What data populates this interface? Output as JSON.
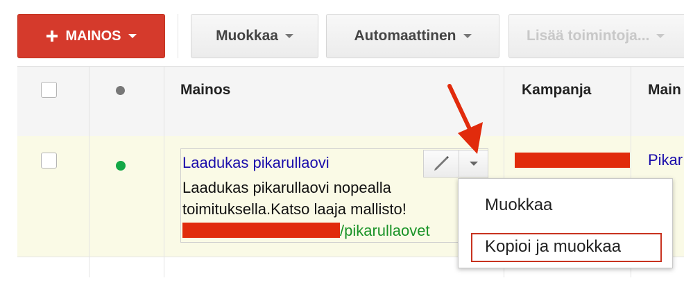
{
  "toolbar": {
    "new_ad_label": "MAINOS",
    "edit_label": "Muokkaa",
    "automatic_label": "Automaattinen",
    "more_actions_label": "Lisää toimintoja..."
  },
  "table": {
    "headers": {
      "ad": "Mainos",
      "campaign": "Kampanja",
      "ad_group_partial": "Main"
    },
    "row": {
      "status": "enabled",
      "ad_title": "Laadukas pikarullaovi",
      "ad_line1": "Laadukas pikarullaovi nopealla",
      "ad_line2": "toimituksella.Katso laaja mallisto!",
      "display_url_suffix": "/pikarullaovet",
      "ad_group_partial": "Pikar"
    }
  },
  "dropdown_menu": {
    "items": [
      "Muokkaa",
      "Kopioi ja muokkaa"
    ],
    "highlighted": "Kopioi ja muokkaa"
  },
  "colors": {
    "new_button": "#d53a2c",
    "link": "#1a0dab",
    "url_green": "#1a9328",
    "status_green": "#13a846",
    "annotation_red": "#e12b0c"
  }
}
